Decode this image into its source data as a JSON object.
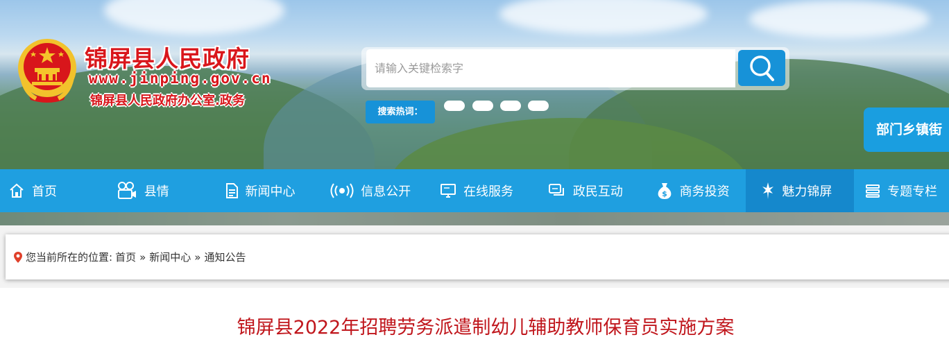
{
  "header": {
    "site_title": "锦屏县人民政府",
    "site_url": "www.jinping.gov.cn",
    "site_subtitle": "锦屏县人民政府办公室.政务",
    "emblem_icon": "national-emblem-icon"
  },
  "search": {
    "placeholder": "请输入关键检索字",
    "value": "",
    "button_icon": "search-icon",
    "hot_label": "搜索热词：",
    "hot_terms": [
      "",
      "",
      "",
      ""
    ]
  },
  "department_button": "部门乡镇街",
  "nav": {
    "items": [
      {
        "label": "首页",
        "icon": "home-icon"
      },
      {
        "label": "县情",
        "icon": "camera-icon"
      },
      {
        "label": "新闻中心",
        "icon": "document-icon"
      },
      {
        "label": "信息公开",
        "icon": "broadcast-icon"
      },
      {
        "label": "在线服务",
        "icon": "monitor-icon"
      },
      {
        "label": "政民互动",
        "icon": "chat-icon"
      },
      {
        "label": "商务投资",
        "icon": "money-bag-icon"
      },
      {
        "label": "魅力锦屏",
        "icon": "sparkle-icon"
      },
      {
        "label": "专题专栏",
        "icon": "stack-icon"
      }
    ],
    "active_index": 7
  },
  "breadcrumb": {
    "prefix": "您当前所在的位置:",
    "items": [
      "首页",
      "新闻中心",
      "通知公告"
    ],
    "separator": "»"
  },
  "article": {
    "title": "锦屏县2022年招聘劳务派遣制幼儿辅助教师保育员实施方案"
  },
  "colors": {
    "brand_red": "#d9161b",
    "nav_blue": "#1f9fe0",
    "nav_active": "#1588cc",
    "title_red": "#c0161c"
  }
}
